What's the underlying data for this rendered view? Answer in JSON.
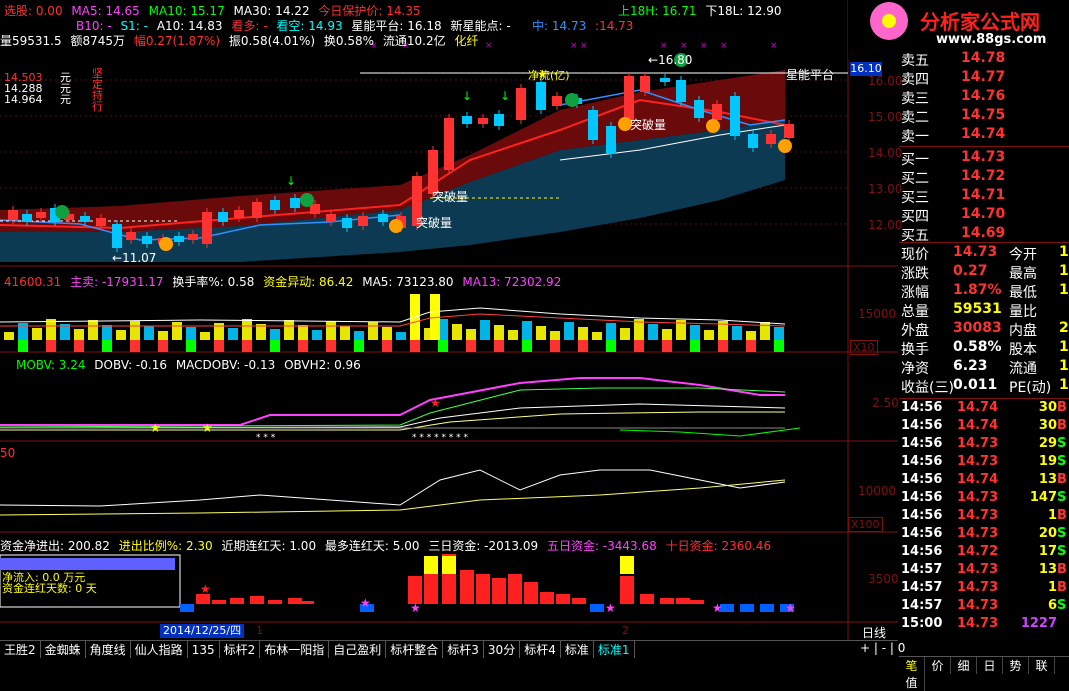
{
  "colors": {
    "bg": "#000000",
    "up": "#ff3232",
    "down": "#00c8ff",
    "flat": "#ffffff",
    "yellow": "#ffff00",
    "magenta": "#ff40ff",
    "green": "#00ff00",
    "cyan": "#00ffff",
    "purple": "#cc44ff",
    "grid": "#801010"
  },
  "main_header": {
    "row1": [
      "选股: 0.00",
      "MA5: 14.65",
      "MA10: 15.17",
      "MA30: 14.22",
      "今日保护价: 14.35",
      "上18H: 16.71",
      "下18L: 12.90"
    ],
    "row2": [
      "B10: -",
      "S1: -",
      "A10: 14.83",
      "看多: -",
      "看空: 14.93",
      "星能平台: 16.18",
      "新星能点: -",
      "中: 14.73",
      ":14.73"
    ],
    "row3": [
      "量59531.5",
      "额8745万",
      "幅0.27(1.87%)",
      "振0.58(4.01%)",
      "换0.58%",
      "流通10.2亿",
      "化纤"
    ]
  },
  "left_labels": {
    "p1": "14.503",
    "p2": "14.288",
    "p3": "14.964",
    "unit": "元",
    "vtext": "坚定持行"
  },
  "price_axis": [
    "16.00",
    "15.00",
    "14.00",
    "13.00",
    "12.00"
  ],
  "price_axis_highlight": "16.10",
  "annotations": {
    "low": "11.07",
    "high": "16.80",
    "breakthrough": "突破量",
    "platform": "星能平台",
    "ok_label": "净流(亿)",
    "platform_short": "平台"
  },
  "volume_panel": {
    "header": [
      "41600.31",
      "主卖: -17931.17",
      "换手率%: 0.58",
      "资金异动: 86.42",
      "MA5: 73123.80",
      "MA13: 72302.92"
    ],
    "axis": [
      "15000"
    ],
    "unit": "X10"
  },
  "obv_panel": {
    "header": [
      "MOBV: 3.24",
      "DOBV: -0.16",
      "MACDOBV: -0.13",
      "OBVH2: 0.96"
    ],
    "axis": [
      "2.50"
    ]
  },
  "panel4": {
    "header": [
      "50"
    ],
    "axis": [
      "10000"
    ],
    "unit": "X100"
  },
  "fund_panel": {
    "header": [
      "资金净进出: 200.82",
      "进出比例%: 2.30",
      "近期连红天: 1.00",
      "最多连红天: 5.00",
      "三日资金: -2013.09",
      "五日资金: -3443.68",
      "十日资金: 2360.46"
    ],
    "axis": [
      "3500"
    ],
    "overlay": [
      "净流入: 0.0 万元",
      "资金连红天数: 0 天"
    ]
  },
  "date_bar": {
    "date": "2014/12/25/四",
    "m1": "1",
    "m2": "2",
    "period": "日线"
  },
  "tabs": [
    "王胜2",
    "金蜘蛛",
    "角度线",
    "仙人指路",
    "135",
    "标杆2",
    "布林一阳指",
    "自己盈利",
    "标杆整合",
    "标杆3",
    "30分",
    "标杆4",
    "标准",
    "标准1"
  ],
  "active_tab": "标准1",
  "logo": {
    "name": "分析家公式网",
    "url": "www.88gs.com"
  },
  "order_book": [
    {
      "label": "卖五",
      "price": "14.78",
      "color": "#ff3232"
    },
    {
      "label": "卖四",
      "price": "14.77",
      "color": "#ff3232"
    },
    {
      "label": "卖三",
      "price": "14.76",
      "color": "#ff3232"
    },
    {
      "label": "卖二",
      "price": "14.75",
      "color": "#ff3232"
    },
    {
      "label": "卖一",
      "price": "14.74",
      "color": "#ff3232"
    },
    {
      "label": "买一",
      "price": "14.73",
      "color": "#ff3232"
    },
    {
      "label": "买二",
      "price": "14.72",
      "color": "#ff3232"
    },
    {
      "label": "买三",
      "price": "14.71",
      "color": "#ff3232"
    },
    {
      "label": "买四",
      "price": "14.70",
      "color": "#ff3232"
    },
    {
      "label": "买五",
      "price": "14.69",
      "color": "#ff3232"
    }
  ],
  "quote": [
    {
      "l1": "现价",
      "v1": "14.73",
      "c1": "#ff3232",
      "l2": "今开",
      "v2": "1"
    },
    {
      "l1": "涨跌",
      "v1": "0.27",
      "c1": "#ff3232",
      "l2": "最高",
      "v2": "1"
    },
    {
      "l1": "涨幅",
      "v1": "1.87%",
      "c1": "#ff3232",
      "l2": "最低",
      "v2": "1"
    },
    {
      "l1": "总量",
      "v1": "59531",
      "c1": "#ffff00",
      "l2": "量比",
      "v2": ""
    },
    {
      "l1": "外盘",
      "v1": "30083",
      "c1": "#ff3232",
      "l2": "内盘",
      "v2": "29"
    },
    {
      "l1": "换手",
      "v1": "0.58%",
      "c1": "#ffffff",
      "l2": "股本",
      "v2": "11"
    },
    {
      "l1": "净资",
      "v1": "6.23",
      "c1": "#ffffff",
      "l2": "流通",
      "v2": "10"
    },
    {
      "l1": "收益(三)",
      "v1": "0.011",
      "c1": "#ffffff",
      "l2": "PE(动)",
      "v2": "10"
    }
  ],
  "ticks": [
    {
      "t": "14:56",
      "p": "14.74",
      "v": "30",
      "d": "B"
    },
    {
      "t": "14:56",
      "p": "14.74",
      "v": "30",
      "d": "B"
    },
    {
      "t": "14:56",
      "p": "14.73",
      "v": "29",
      "d": "S"
    },
    {
      "t": "14:56",
      "p": "14.73",
      "v": "19",
      "d": "S"
    },
    {
      "t": "14:56",
      "p": "14.74",
      "v": "13",
      "d": "B"
    },
    {
      "t": "14:56",
      "p": "14.73",
      "v": "147",
      "d": "S"
    },
    {
      "t": "14:56",
      "p": "14.73",
      "v": "1",
      "d": "B"
    },
    {
      "t": "14:56",
      "p": "14.73",
      "v": "20",
      "d": "S"
    },
    {
      "t": "14:56",
      "p": "14.72",
      "v": "17",
      "d": "S"
    },
    {
      "t": "14:57",
      "p": "14.73",
      "v": "13",
      "d": "B"
    },
    {
      "t": "14:57",
      "p": "14.73",
      "v": "1",
      "d": "B"
    },
    {
      "t": "14:57",
      "p": "14.73",
      "v": "6",
      "d": "S"
    },
    {
      "t": "15:00",
      "p": "14.73",
      "v": "1227",
      "d": ""
    }
  ],
  "bottom_tabs": [
    "笔",
    "价",
    "细",
    "日",
    "势",
    "联",
    "值"
  ]
}
